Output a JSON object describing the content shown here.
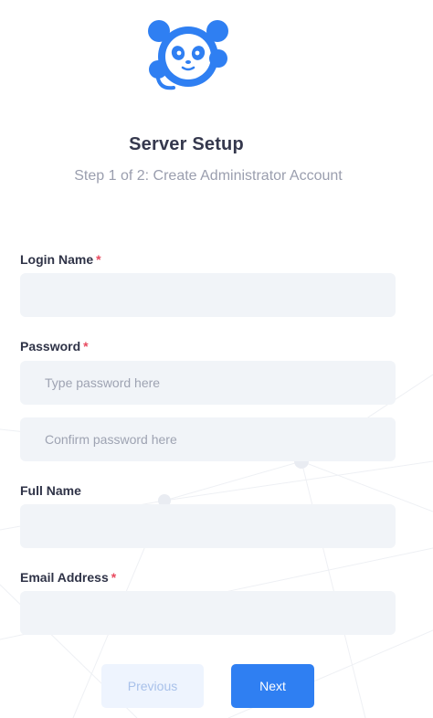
{
  "header": {
    "logo_icon": "panda-headset-logo-icon",
    "title": "Server Setup",
    "subtitle": "Step 1 of 2: Create Administrator Account"
  },
  "form": {
    "login_name": {
      "label": "Login Name",
      "required_mark": "*",
      "value": "",
      "placeholder": ""
    },
    "password": {
      "label": "Password",
      "required_mark": "*",
      "value": "",
      "placeholder": "Type password here",
      "confirm_value": "",
      "confirm_placeholder": "Confirm password here"
    },
    "full_name": {
      "label": "Full Name",
      "value": "",
      "placeholder": ""
    },
    "email": {
      "label": "Email Address",
      "required_mark": "*",
      "value": "",
      "placeholder": ""
    }
  },
  "buttons": {
    "previous_label": "Previous",
    "previous_state": "disabled",
    "next_label": "Next"
  },
  "colors": {
    "accent": "#2f7ff2",
    "required": "#e84a5f",
    "input_bg": "#f1f4f8",
    "title": "#35384d",
    "subtitle": "#9a9eae"
  }
}
